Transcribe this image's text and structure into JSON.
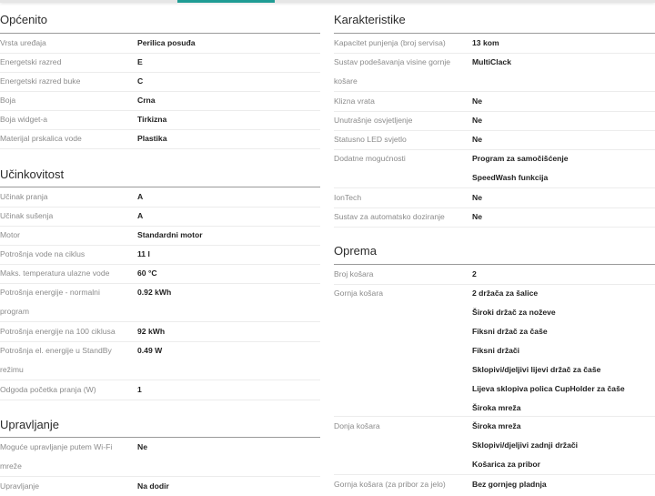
{
  "left": {
    "opcenito": {
      "title": "Općenito",
      "rows": [
        {
          "label": "Vrsta uređaja",
          "value": "Perilica posuđa"
        },
        {
          "label": "Energetski razred",
          "value": "E"
        },
        {
          "label": "Energetski razred buke",
          "value": "C"
        },
        {
          "label": "Boja",
          "value": "Crna"
        },
        {
          "label": "Boja widget-a",
          "value": "Tirkizna"
        },
        {
          "label": "Materijal prskalica vode",
          "value": "Plastika"
        }
      ]
    },
    "ucinkovitost": {
      "title": "Učinkovitost",
      "rows": [
        {
          "label": "Učinak pranja",
          "value": "A"
        },
        {
          "label": "Učinak sušenja",
          "value": "A"
        },
        {
          "label": "Motor",
          "value": "Standardni motor"
        },
        {
          "label": "Potrošnja vode na ciklus",
          "value": "11 l"
        },
        {
          "label": "Maks. temperatura ulazne vode",
          "value": "60 °C"
        },
        {
          "label": "Potrošnja energije - normalni",
          "label2": "program",
          "value": "0.92 kWh"
        },
        {
          "label": "Potrošnja energije na 100 ciklusa",
          "value": "92 kWh"
        },
        {
          "label": "Potrošnja el. energije u StandBy",
          "label2": "režimu",
          "value": "0.49 W"
        },
        {
          "label": "Odgoda početka pranja (W)",
          "value": "1"
        }
      ]
    },
    "upravljanje": {
      "title": "Upravljanje",
      "rows": [
        {
          "label": "Moguće upravljanje putem Wi-Fi",
          "label2": "mreže",
          "value": "Ne"
        },
        {
          "label": "Upravljanje",
          "value": "Na dodir"
        }
      ]
    }
  },
  "right": {
    "karakteristike": {
      "title": "Karakteristike",
      "rows": [
        {
          "label": "Kapacitet punjenja (broj servisa)",
          "value": "13 kom"
        },
        {
          "label": "Sustav podešavanja visine gornje",
          "label2": "košare",
          "value": "MultiClack"
        },
        {
          "label": "Klizna vrata",
          "value": "Ne"
        },
        {
          "label": "Unutrašnje osvjetljenje",
          "value": "Ne"
        },
        {
          "label": "Statusno LED svjetlo",
          "value": "Ne"
        },
        {
          "label": "Dodatne mogućnosti",
          "value": "Program za samočišćenje",
          "value2": "SpeedWash funkcija"
        },
        {
          "label": "IonTech",
          "value": "Ne"
        },
        {
          "label": "Sustav za automatsko doziranje",
          "value": "Ne"
        }
      ]
    },
    "oprema": {
      "title": "Oprema",
      "rows": [
        {
          "label": "Broj košara",
          "value": "2"
        },
        {
          "label": "Gornja košara",
          "values": [
            "2 držača za šalice",
            "Široki držač za noževe",
            "Fiksni držač za čaše",
            "Fiksni držači",
            "Sklopivi/djeljivi lijevi držač za čaše",
            "Lijeva sklopiva polica CupHolder za čaše",
            "Široka mreža"
          ]
        },
        {
          "label": "Donja košara",
          "values": [
            "Široka mreža",
            "Sklopivi/djeljivi zadnji držači",
            "Košarica za pribor"
          ]
        },
        {
          "label": "Gornja košara (za pribor za jelo)",
          "value": "Bez gornjeg pladnja"
        }
      ]
    }
  }
}
